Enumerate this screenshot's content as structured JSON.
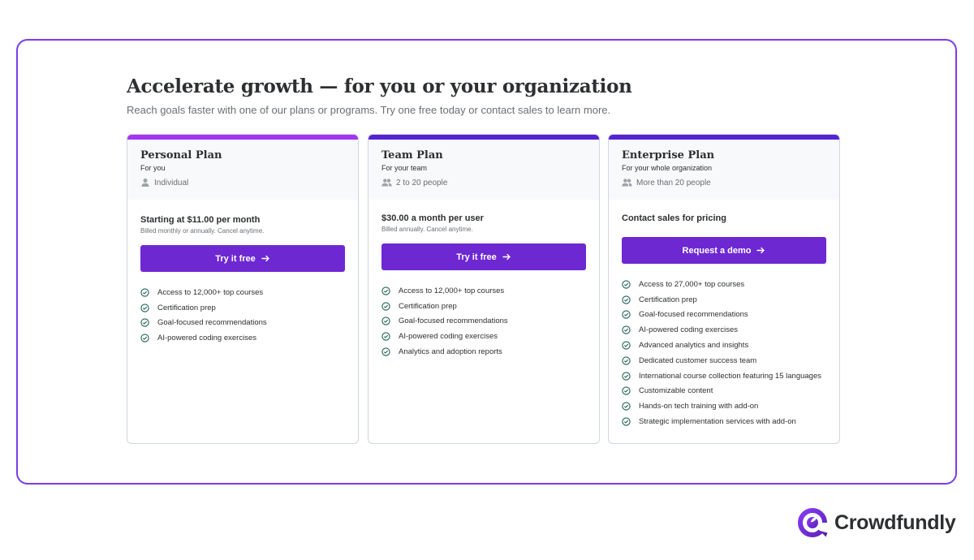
{
  "header": {
    "title": "Accelerate growth — for you or your organization",
    "subtitle": "Reach goals faster with one of our plans or programs. Try one free today or contact sales to learn more."
  },
  "colors": {
    "accent": "#6d28d2",
    "personal_bar": "#a435f0",
    "team_bar": "#5624d0",
    "enterprise_bar": "#5624d0",
    "check": "#1e6055"
  },
  "plans": [
    {
      "name": "Personal Plan",
      "for": "For you",
      "audience_icon": "person-icon",
      "audience": "Individual",
      "price": "Starting at $11.00 per month",
      "billing": "Billed monthly or annually. Cancel anytime.",
      "cta": "Try it free",
      "features": [
        "Access to 12,000+ top courses",
        "Certification prep",
        "Goal-focused recommendations",
        "AI-powered coding exercises"
      ]
    },
    {
      "name": "Team Plan",
      "for": "For your team",
      "audience_icon": "group-icon",
      "audience": "2 to 20 people",
      "price": "$30.00 a month per user",
      "billing": "Billed annually. Cancel anytime.",
      "cta": "Try it free",
      "features": [
        "Access to 12,000+ top courses",
        "Certification prep",
        "Goal-focused recommendations",
        "AI-powered coding exercises",
        "Analytics and adoption reports"
      ]
    },
    {
      "name": "Enterprise Plan",
      "for": "For your whole organization",
      "audience_icon": "group-icon",
      "audience": "More than 20 people",
      "price": "Contact sales for pricing",
      "billing": "",
      "cta": "Request a demo",
      "features": [
        "Access to 27,000+ top courses",
        "Certification prep",
        "Goal-focused recommendations",
        "AI-powered coding exercises",
        "Advanced analytics and insights",
        "Dedicated customer success team",
        "International course collection featuring 15 languages",
        "Customizable content",
        "Hands-on tech training with add-on",
        "Strategic implementation services with add-on"
      ]
    }
  ],
  "brand": {
    "name": "Crowdfundly",
    "icon": "crowdfundly-logo-icon"
  }
}
